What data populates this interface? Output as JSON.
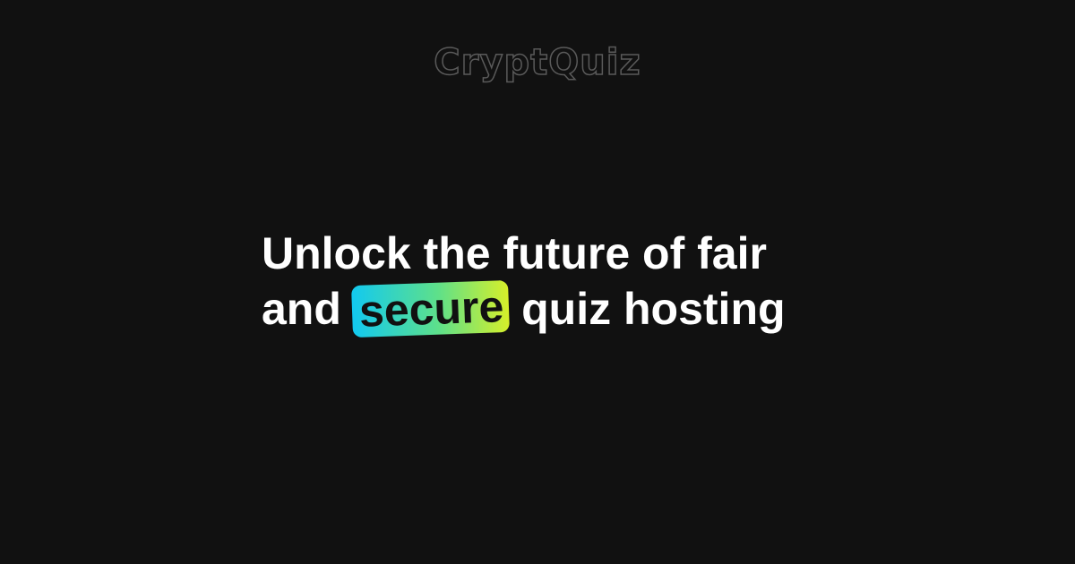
{
  "brand": {
    "name": "CryptQuiz",
    "outline_color": "#5a5a5a"
  },
  "headline": {
    "line1": "Unlock the future of fair",
    "line2_before": "and",
    "highlight": "secure",
    "line2_after": "quiz hosting"
  },
  "colors": {
    "background": "#111111",
    "text": "#ffffff",
    "highlight_gradient": [
      "#12c9f0",
      "#5ee08a",
      "#d6ef2a"
    ]
  }
}
